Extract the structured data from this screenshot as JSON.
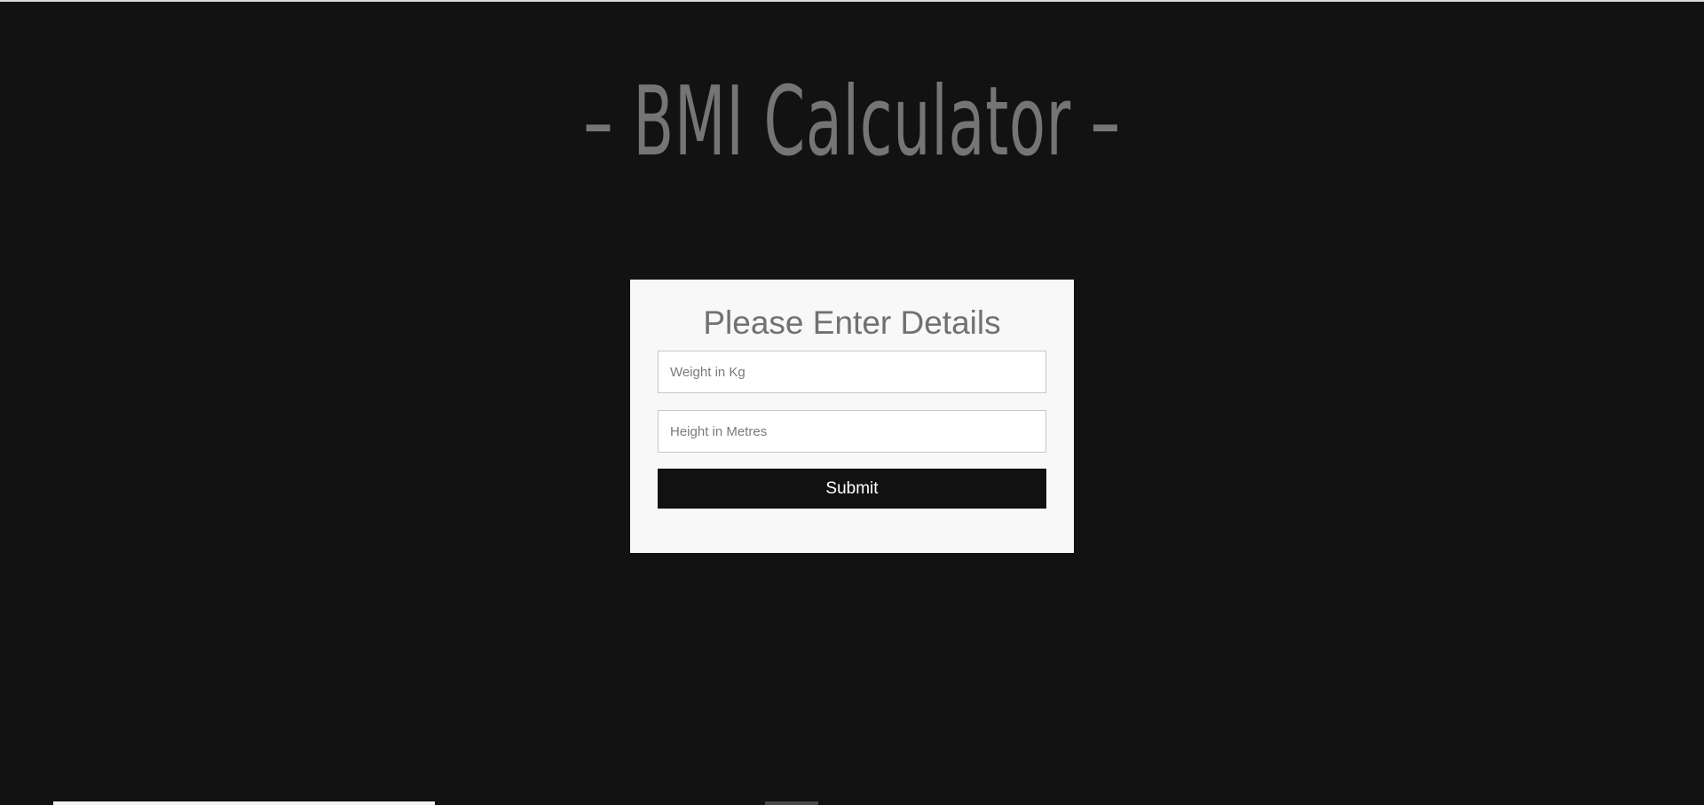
{
  "header": {
    "title": "– BMI Calculator –"
  },
  "form": {
    "heading": "Please Enter Details",
    "weight": {
      "placeholder": "Weight in Kg",
      "value": ""
    },
    "height": {
      "placeholder": "Height in Metres",
      "value": ""
    },
    "submit_label": "Submit"
  },
  "colors": {
    "background": "#121212",
    "card": "#f8f8f8",
    "title": "#757575",
    "button": "#111111",
    "button_text": "#ffffff"
  }
}
